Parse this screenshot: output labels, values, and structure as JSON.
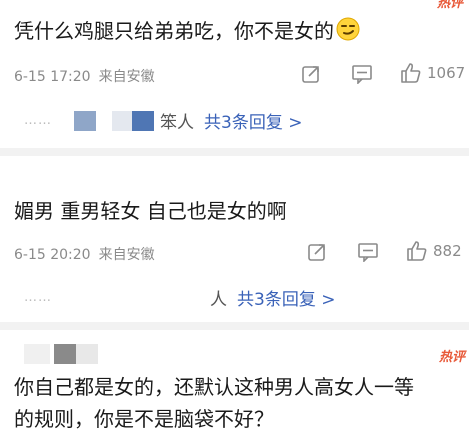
{
  "comments": [
    {
      "text": "凭什么鸡腿只给弟弟吃，你不是女的",
      "emoji": "smirk-face",
      "date": "6-15 17:20",
      "source": "来自安徽",
      "likes": "1067",
      "reply_name_fragment": "笨人",
      "reply_link": "共3条回复 >"
    },
    {
      "text": "媚男 重男轻女 自己也是女的啊",
      "date": "6-15 20:20",
      "source": "来自安徽",
      "likes": "882",
      "reply_name_fragment": "人",
      "reply_link": "共3条回复 >"
    },
    {
      "badge": "热评",
      "line1": "你自己都是女的，还默认这种男人高女人一等",
      "line2": "的规则，你是不是脑袋不好？"
    }
  ],
  "top_badge": "热评",
  "dots": "……",
  "icons": [
    "share-icon",
    "comment-icon",
    "like-icon"
  ],
  "colors": {
    "link": "#3a62b8",
    "meta": "#8a8a8a",
    "hot": "#e85a3a",
    "separator": "#f2f2f2"
  }
}
